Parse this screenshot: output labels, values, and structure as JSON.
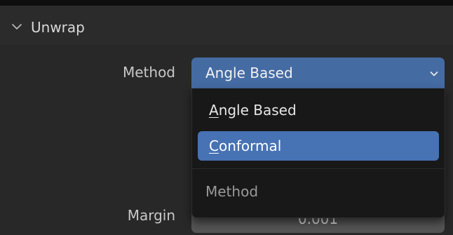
{
  "panel": {
    "title": "Unwrap"
  },
  "method": {
    "label": "Method",
    "value": "Angle Based"
  },
  "margin": {
    "label": "Margin",
    "value": "0.001"
  },
  "dropdown": {
    "options": [
      {
        "accel": "A",
        "rest": "ngle Based",
        "highlighted": false
      },
      {
        "accel": "C",
        "rest": "onformal",
        "highlighted": true
      }
    ],
    "title": "Method"
  },
  "colors": {
    "accent": "#4772b3",
    "field": "#456ba3",
    "menu_bg": "#181818",
    "panel_bg": "#282828"
  },
  "icons": {
    "header": "chevron-down-icon",
    "select": "chevron-down-icon"
  }
}
